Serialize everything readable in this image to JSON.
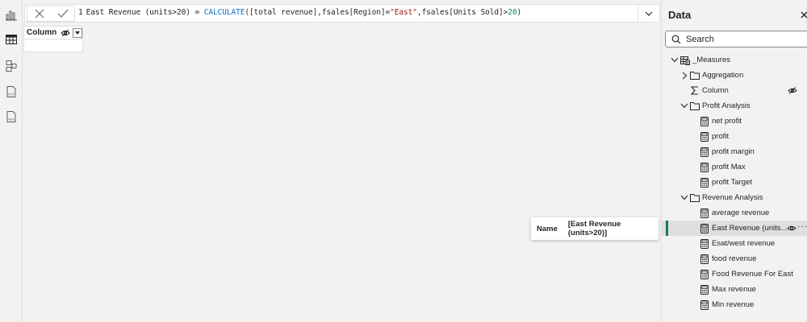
{
  "formula": {
    "line_number": "1",
    "tokens": [
      {
        "t": "East Revenue (units>20) = ",
        "c": "def"
      },
      {
        "t": "CALCULATE",
        "c": "fn"
      },
      {
        "t": "([total revenue],fsales[Region]=",
        "c": "def"
      },
      {
        "t": "\"East\"",
        "c": "str"
      },
      {
        "t": ",fsales[Units Sold]>",
        "c": "def"
      },
      {
        "t": "20",
        "c": "num"
      },
      {
        "t": ")",
        "c": "def"
      }
    ]
  },
  "table_preview": {
    "column_header": "Column"
  },
  "tooltip": {
    "label": "Name",
    "value": "[East Revenue (units>20)]"
  },
  "data_pane": {
    "title": "Data",
    "search_placeholder": "Search",
    "items": [
      {
        "label": "_Measures",
        "level": 0,
        "expand": "down",
        "icon": "table"
      },
      {
        "label": "Aggregation",
        "level": 1,
        "expand": "right",
        "icon": "folder"
      },
      {
        "label": "Column",
        "level": 1,
        "expand": "none",
        "icon": "sigma",
        "hidden": true
      },
      {
        "label": "Profit Analysis",
        "level": 1,
        "expand": "down",
        "icon": "folder"
      },
      {
        "label": "net profit",
        "level": 2,
        "icon": "calc"
      },
      {
        "label": "profit",
        "level": 2,
        "icon": "calc"
      },
      {
        "label": "profit margin",
        "level": 2,
        "icon": "calc"
      },
      {
        "label": "profit Max",
        "level": 2,
        "icon": "calc"
      },
      {
        "label": "profit Target",
        "level": 2,
        "icon": "calc"
      },
      {
        "label": "Revenue Analysis",
        "level": 1,
        "expand": "down",
        "icon": "folder"
      },
      {
        "label": "average revenue",
        "level": 2,
        "icon": "calc"
      },
      {
        "label": "East Revenue (units...",
        "level": 2,
        "icon": "calc",
        "selected": true
      },
      {
        "label": "Esat/west revenue",
        "level": 2,
        "icon": "calc"
      },
      {
        "label": "food revenue",
        "level": 2,
        "icon": "calc"
      },
      {
        "label": "Food Revenue For East",
        "level": 2,
        "icon": "calc"
      },
      {
        "label": "Max revenue",
        "level": 2,
        "icon": "calc"
      },
      {
        "label": "Min revenue",
        "level": 2,
        "icon": "calc"
      }
    ]
  },
  "colors": {
    "accent": "#117865",
    "function": "#0e70c0",
    "string": "#a31515",
    "number": "#098658"
  }
}
